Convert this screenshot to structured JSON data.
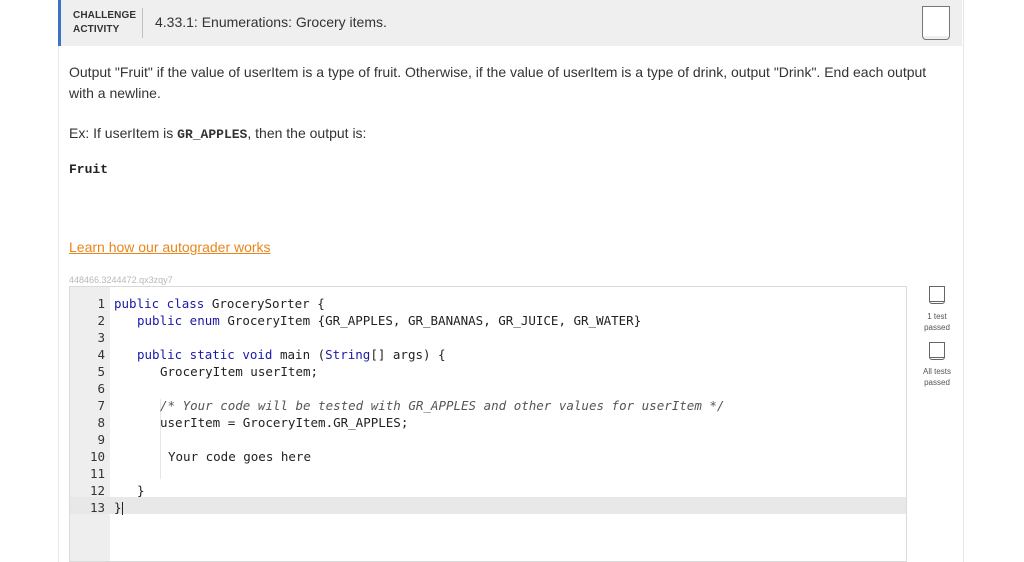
{
  "header": {
    "label_line1": "CHALLENGE",
    "label_line2": "ACTIVITY",
    "title": "4.33.1: Enumerations: Grocery items."
  },
  "instructions": {
    "text": "Output \"Fruit\" if the value of userItem is a type of fruit. Otherwise, if the value of userItem is a type of drink, output \"Drink\". End each output with a newline.",
    "example_prefix": "Ex: If userItem is ",
    "example_code": "GR_APPLES",
    "example_suffix": ", then the output is:",
    "output_sample": "Fruit"
  },
  "autograder_link": "Learn how our autograder works",
  "code_id": "448466.3244472.qx3zqy7",
  "editor": {
    "line_numbers": [
      "1",
      "2",
      "3",
      "4",
      "5",
      "6",
      "7",
      "8",
      "9",
      "10",
      "11",
      "12",
      "13"
    ],
    "lines": {
      "l1_kw": "public class",
      "l1_rest": " GrocerySorter {",
      "l2_kw": "public enum",
      "l2_rest": " GroceryItem {GR_APPLES, GR_BANANAS, GR_JUICE, GR_WATER}",
      "l4_kw": "public static void",
      "l4_rest": " main (",
      "l4_type": "String",
      "l4_end": "[] args) {",
      "l5": "GroceryItem userItem;",
      "l7_comment": "/* Your code will be tested with GR_APPLES and other values for userItem */",
      "l8": "userItem = GroceryItem.GR_APPLES;",
      "l10": "Your code goes here",
      "l12": "}",
      "l13": "}"
    }
  },
  "status": {
    "test1_line1": "1 test",
    "test1_line2": "passed",
    "test2_line1": "All tests",
    "test2_line2": "passed"
  },
  "colors": {
    "accent": "#3b74c4",
    "link": "#e8861c",
    "keyword": "#1a1aa6"
  }
}
